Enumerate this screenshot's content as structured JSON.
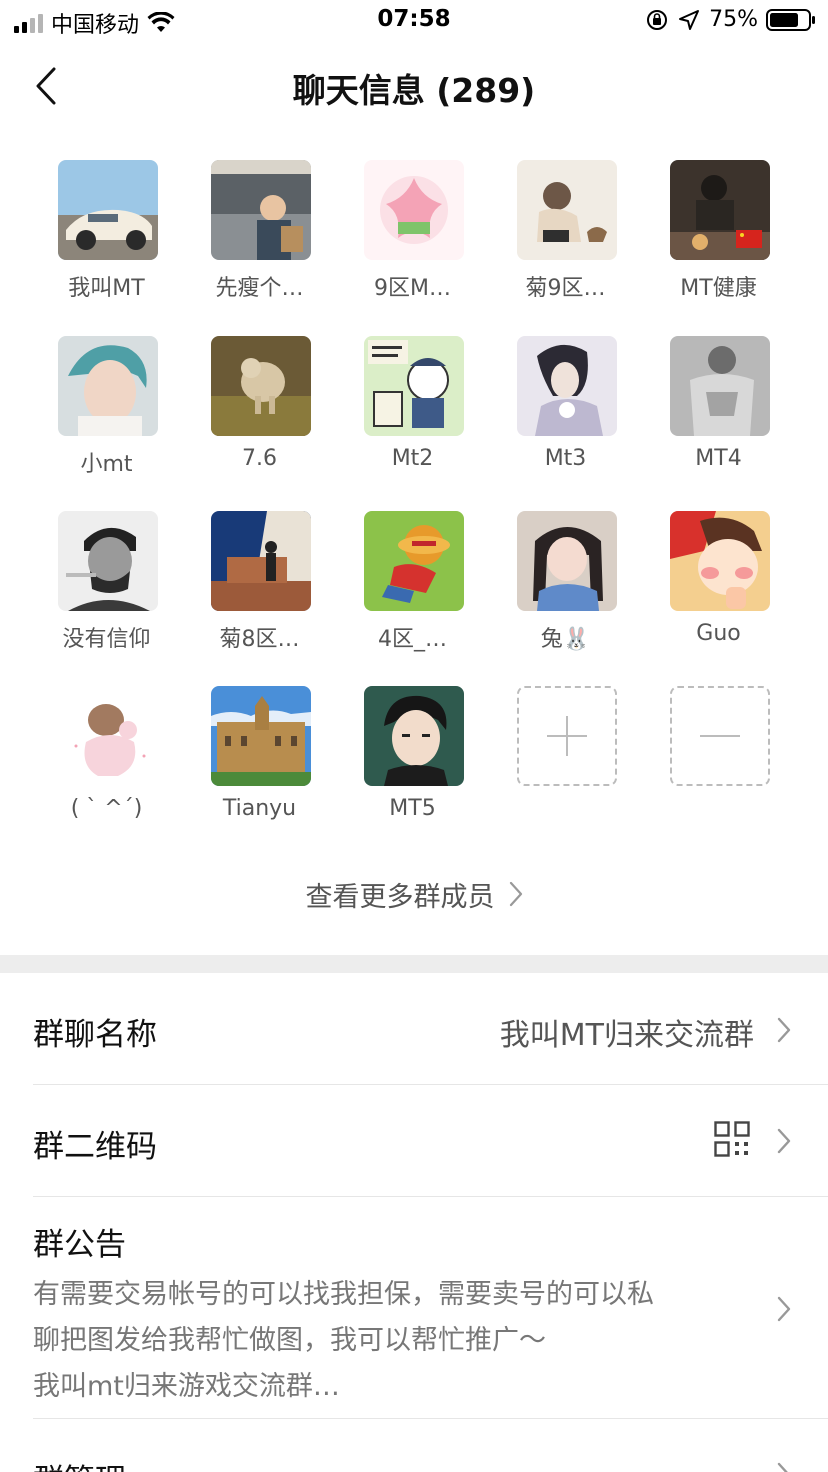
{
  "status_bar": {
    "carrier": "中国移动",
    "time": "07:58",
    "battery": "75%",
    "battery_level": 0.75
  },
  "nav": {
    "title": "聊天信息 (289)",
    "back_icon": "chevron-left-icon"
  },
  "members": [
    {
      "name": "我叫MT",
      "avatar": "white-sports-car"
    },
    {
      "name": "先瘦个…",
      "avatar": "toddler-in-restaurant"
    },
    {
      "name": "9区M…",
      "avatar": "pink-starfish"
    },
    {
      "name": "菊9区…",
      "avatar": "sleeping-cartoon-kid"
    },
    {
      "name": "MT健康",
      "avatar": "man-at-dinner-table"
    },
    {
      "name": "小mt",
      "avatar": "teal-haired-person"
    },
    {
      "name": "7.6",
      "avatar": "fluffy-dog-on-grass"
    },
    {
      "name": "Mt2",
      "avatar": "police-bear-meme"
    },
    {
      "name": "Mt3",
      "avatar": "anime-swordsman"
    },
    {
      "name": "MT4",
      "avatar": "muscular-man-grayscale"
    },
    {
      "name": "没有信仰",
      "avatar": "bearded-revolutionary-bw"
    },
    {
      "name": "菊8区…",
      "avatar": "man-on-stairs"
    },
    {
      "name": "4区_…",
      "avatar": "straw-hat-pirate-on-grass"
    },
    {
      "name": "兔🐰",
      "avatar": "girl-with-braids"
    },
    {
      "name": "Guo",
      "avatar": "blushing-anime-face"
    },
    {
      "name": "( ˋ ^ˊ)",
      "avatar": "cartoon-baby-with-pig"
    },
    {
      "name": "Tianyu",
      "avatar": "sandstone-university-building"
    },
    {
      "name": "MT5",
      "avatar": "anime-boy-black-hair"
    }
  ],
  "add_member_icon": "plus-icon",
  "remove_member_icon": "minus-icon",
  "see_more": "查看更多群成员",
  "settings": {
    "group_name_label": "群聊名称",
    "group_name_value": "我叫MT归来交流群",
    "qr_label": "群二维码",
    "qr_icon": "qr-code-icon",
    "notice_label": "群公告",
    "notice_lines": [
      "有需要交易帐号的可以找我担保，需要卖号的可以私",
      "聊把图发给我帮忙做图，我可以帮忙推广～",
      "我叫mt归来游戏交流群…"
    ],
    "manage_label": "群管理"
  },
  "colors": {
    "divider": "#e6e6e6",
    "section_gap": "#ededed",
    "secondary_text": "#555555",
    "dashed_border": "#bcbcbc"
  }
}
